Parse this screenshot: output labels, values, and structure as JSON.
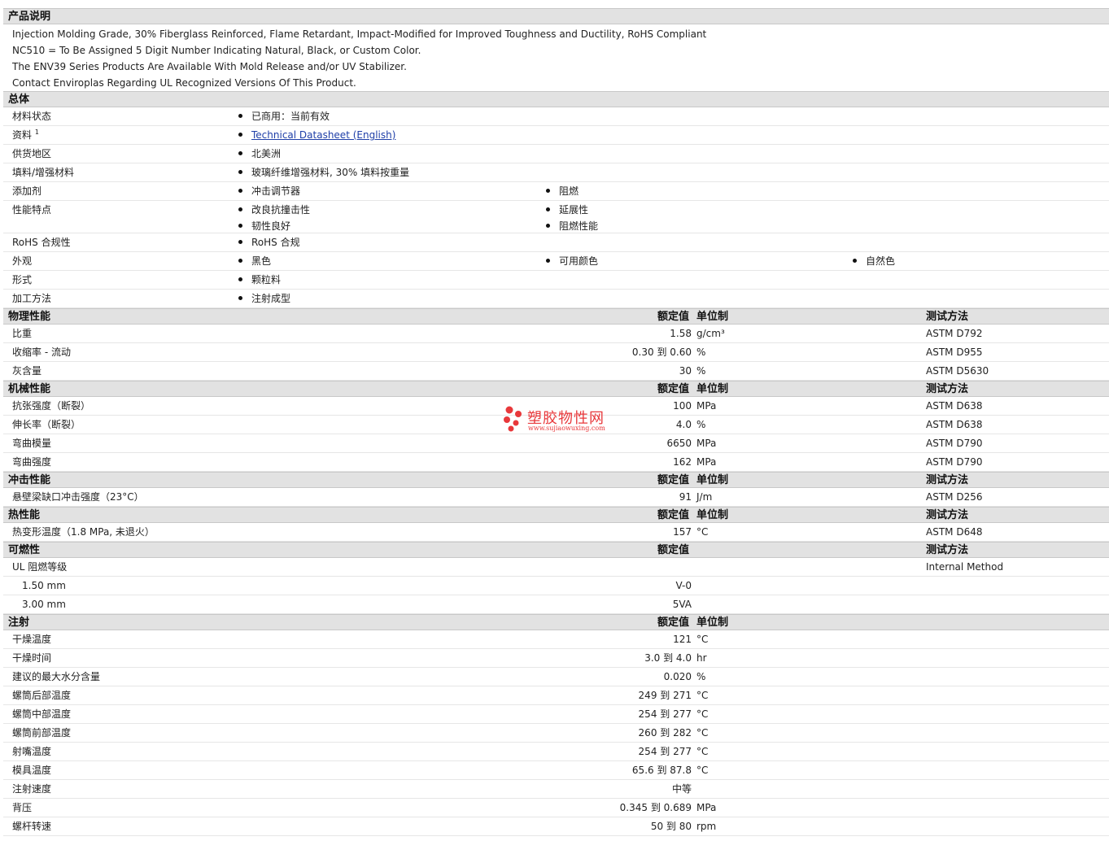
{
  "description": {
    "title": "产品说明",
    "lines": [
      "Injection Molding Grade, 30% Fiberglass Reinforced, Flame Retardant, Impact-Modified for Improved Toughness and Ductility, RoHS Compliant",
      "NC510 = To Be Assigned 5 Digit Number Indicating Natural, Black, or Custom Color.",
      "The ENV39 Series Products Are Available With Mold Release and/or UV Stabilizer.",
      "Contact Enviroplas Regarding UL Recognized Versions Of This Product."
    ]
  },
  "general": {
    "title": "总体",
    "rows": [
      {
        "label": "材料状态",
        "cols": [
          [
            "已商用：当前有效"
          ]
        ]
      },
      {
        "label": "资料",
        "sup": "1",
        "cols": [
          [
            "Technical Datasheet (English)"
          ]
        ],
        "link": true
      },
      {
        "label": "供货地区",
        "cols": [
          [
            "北美洲"
          ]
        ]
      },
      {
        "label": "填料/增强材料",
        "cols": [
          [
            "玻璃纤维增强材料, 30% 填料按重量"
          ]
        ]
      },
      {
        "label": "添加剂",
        "cols": [
          [
            "冲击调节器"
          ],
          [
            "阻燃"
          ]
        ]
      },
      {
        "label": "性能特点",
        "cols": [
          [
            "改良抗撞击性",
            "韧性良好"
          ],
          [
            "延展性",
            "阻燃性能"
          ]
        ]
      },
      {
        "label": "RoHS 合规性",
        "cols": [
          [
            "RoHS 合规"
          ]
        ]
      },
      {
        "label": "外观",
        "cols": [
          [
            "黑色"
          ],
          [
            "可用颜色"
          ],
          [
            "自然色"
          ]
        ]
      },
      {
        "label": "形式",
        "cols": [
          [
            "颗粒料"
          ]
        ]
      },
      {
        "label": "加工方法",
        "cols": [
          [
            "注射成型"
          ]
        ]
      }
    ]
  },
  "header_labels": {
    "nominal": "额定值",
    "unit": "单位制",
    "test": "测试方法"
  },
  "sections": [
    {
      "title": "物理性能",
      "headers": [
        "nominal",
        "unit",
        "test"
      ],
      "rows": [
        {
          "label": "比重",
          "value": "1.58",
          "unit": "g/cm³",
          "test": "ASTM D792"
        },
        {
          "label": "收缩率 - 流动",
          "value": "0.30 到  0.60",
          "unit": "%",
          "test": "ASTM D955"
        },
        {
          "label": "灰含量",
          "value": "30",
          "unit": "%",
          "test": "ASTM D5630"
        }
      ]
    },
    {
      "title": "机械性能",
      "headers": [
        "nominal",
        "unit",
        "test"
      ],
      "rows": [
        {
          "label": "抗张强度（断裂）",
          "value": "100",
          "unit": "MPa",
          "test": "ASTM D638"
        },
        {
          "label": "伸长率（断裂）",
          "value": "4.0",
          "unit": "%",
          "test": "ASTM D638"
        },
        {
          "label": "弯曲模量",
          "value": "6650",
          "unit": "MPa",
          "test": "ASTM D790"
        },
        {
          "label": "弯曲强度",
          "value": "162",
          "unit": "MPa",
          "test": "ASTM D790"
        }
      ]
    },
    {
      "title": "冲击性能",
      "headers": [
        "nominal",
        "unit",
        "test"
      ],
      "rows": [
        {
          "label": "悬壁梁缺口冲击强度（23°C）",
          "value": "91",
          "unit": "J/m",
          "test": "ASTM D256"
        }
      ]
    },
    {
      "title": "热性能",
      "headers": [
        "nominal",
        "unit",
        "test"
      ],
      "rows": [
        {
          "label": "热变形温度（1.8 MPa, 未退火）",
          "value": "157",
          "unit": "°C",
          "test": "ASTM D648"
        }
      ]
    },
    {
      "title": "可燃性",
      "headers": [
        "nominal",
        "test"
      ],
      "rows": [
        {
          "label": "UL 阻燃等级",
          "value": "",
          "unit": "",
          "test": "Internal Method"
        },
        {
          "label": "1.50 mm",
          "indent": true,
          "value": "V-0",
          "unit": "",
          "test": ""
        },
        {
          "label": "3.00 mm",
          "indent": true,
          "value": "5VA",
          "unit": "",
          "test": ""
        }
      ]
    },
    {
      "title": "注射",
      "headers": [
        "nominal",
        "unit"
      ],
      "rows": [
        {
          "label": "干燥温度",
          "value": "121",
          "unit": "°C",
          "test": ""
        },
        {
          "label": "干燥时间",
          "value": "3.0 到  4.0",
          "unit": "hr",
          "test": ""
        },
        {
          "label": "建议的最大水分含量",
          "value": "0.020",
          "unit": "%",
          "test": ""
        },
        {
          "label": "螺筒后部温度",
          "value": "249 到  271",
          "unit": "°C",
          "test": ""
        },
        {
          "label": "螺筒中部温度",
          "value": "254 到  277",
          "unit": "°C",
          "test": ""
        },
        {
          "label": "螺筒前部温度",
          "value": "260 到  282",
          "unit": "°C",
          "test": ""
        },
        {
          "label": "射嘴温度",
          "value": "254 到  277",
          "unit": "°C",
          "test": ""
        },
        {
          "label": "模具温度",
          "value": "65.6 到  87.8",
          "unit": "°C",
          "test": ""
        },
        {
          "label": "注射速度",
          "value": "中等",
          "unit": "",
          "test": ""
        },
        {
          "label": "背压",
          "value": "0.345 到  0.689",
          "unit": "MPa",
          "test": ""
        },
        {
          "label": "螺杆转速",
          "value": "50 到  80",
          "unit": "rpm",
          "test": ""
        }
      ]
    }
  ],
  "watermark": {
    "name": "塑胶物性网",
    "url": "www.sujiaowuxing.com",
    "color": "#e8383b"
  }
}
